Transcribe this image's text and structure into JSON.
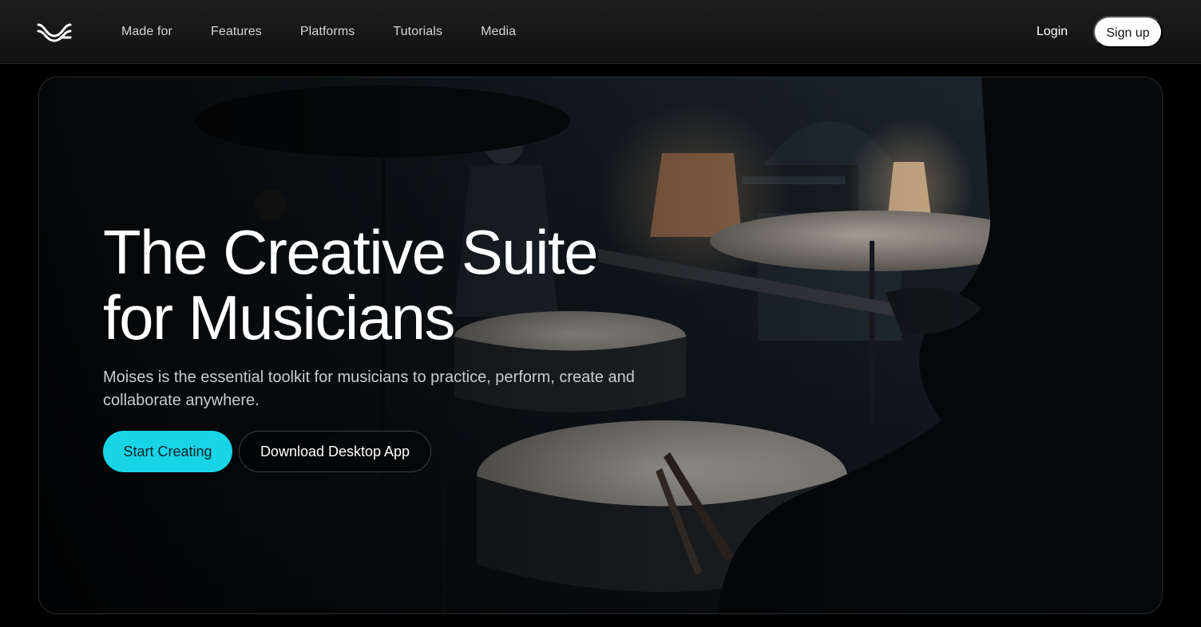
{
  "brand": {
    "logo_icon": "moises-wave-logo-icon"
  },
  "nav": {
    "items": [
      {
        "label": "Made for"
      },
      {
        "label": "Features"
      },
      {
        "label": "Platforms"
      },
      {
        "label": "Tutorials"
      },
      {
        "label": "Media"
      }
    ],
    "login_label": "Login",
    "signup_label": "Sign up"
  },
  "hero": {
    "title_line1": "The Creative Suite",
    "title_line2": "for Musicians",
    "description": "Moises is the essential toolkit for musicians to practice, perform, create and collaborate anywhere.",
    "primary_cta": "Start Creating",
    "secondary_cta": "Download Desktop App",
    "background": "drummer-playing-drums-photo"
  },
  "colors": {
    "accent": "#18d4e6",
    "nav_bg": "#161616",
    "page_bg": "#000000"
  }
}
